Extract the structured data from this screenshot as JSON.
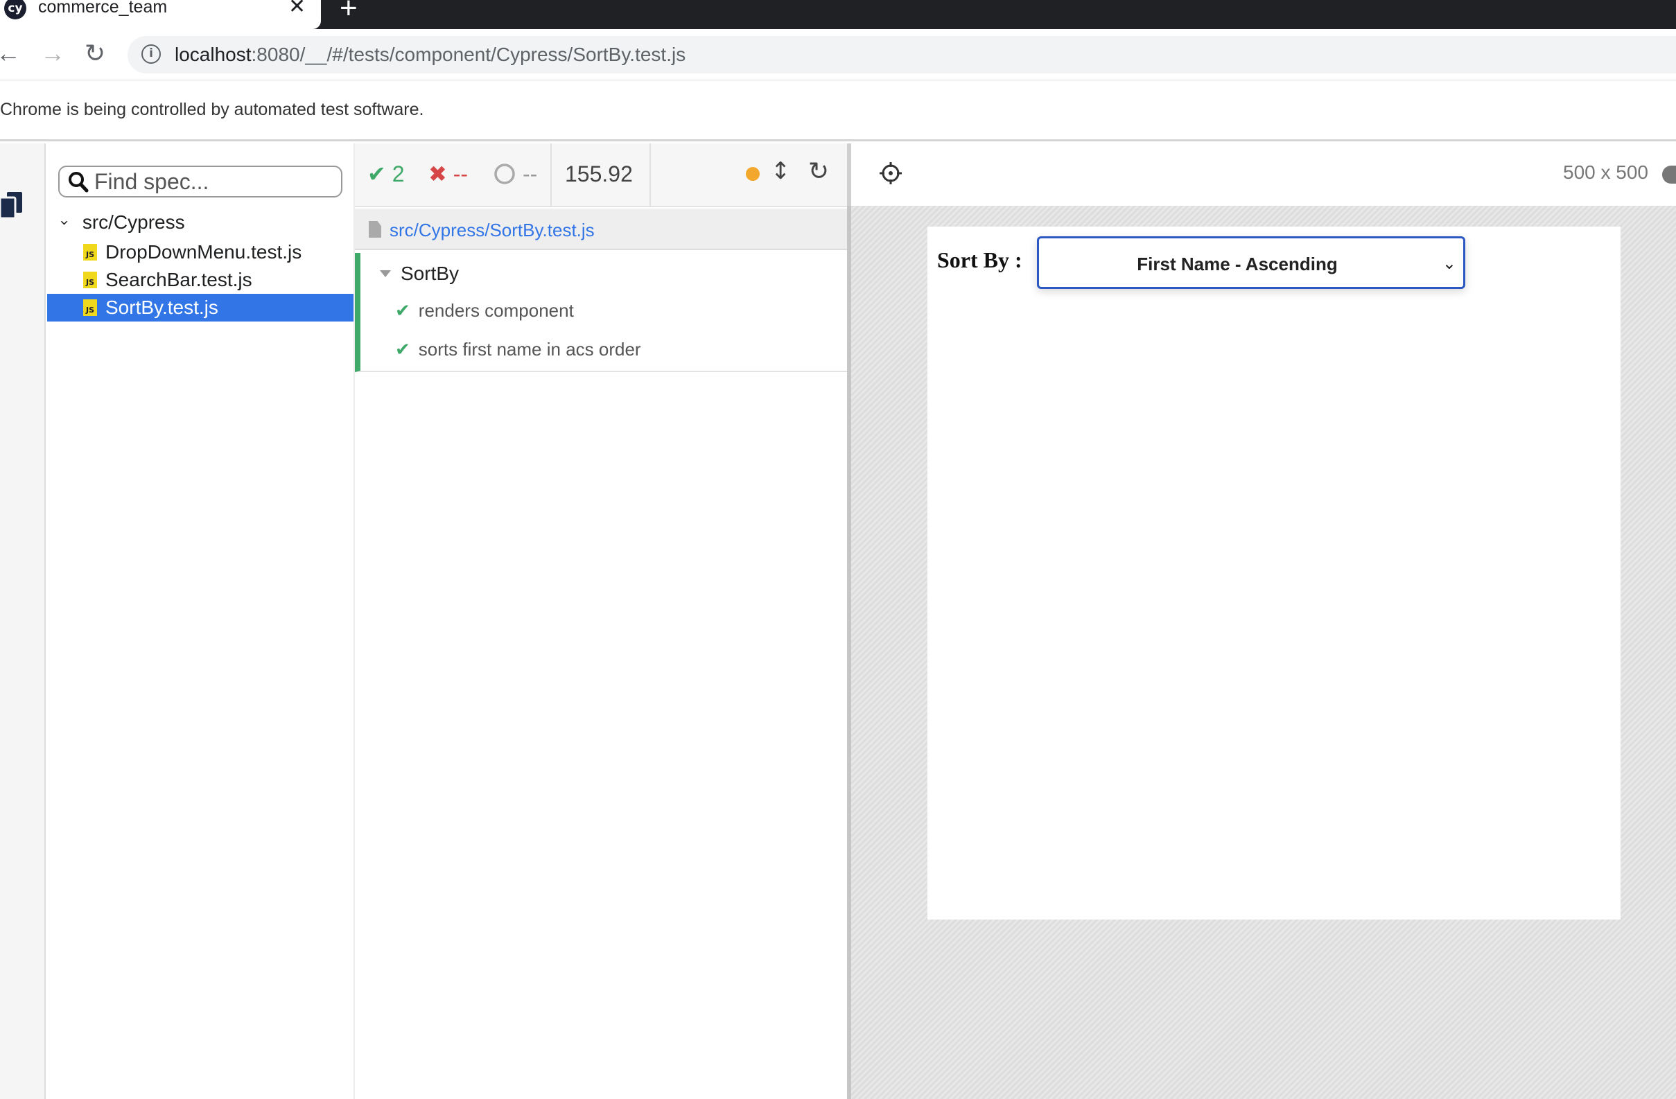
{
  "browser": {
    "tab_title": "commerce_team",
    "favicon_text": "cy",
    "close_glyph": "✕",
    "newtab_glyph": "+",
    "back_glyph": "←",
    "forward_glyph": "→",
    "reload_glyph": "↻",
    "info_glyph": "i",
    "url_host": "localhost",
    "url_rest": ":8080/__/#/tests/component/Cypress/SortBy.test.js",
    "infobar": "Chrome is being controlled by automated test software."
  },
  "specs": {
    "search_placeholder": "Find spec...",
    "folder": "src/Cypress",
    "files": [
      {
        "name": "DropDownMenu.test.js",
        "active": false
      },
      {
        "name": "SearchBar.test.js",
        "active": false
      },
      {
        "name": "SortBy.test.js",
        "active": true
      }
    ],
    "js_badge": "JS"
  },
  "reporter": {
    "passed": "2",
    "failed": "--",
    "pending": "--",
    "duration": "155.92",
    "pass_glyph": "✔",
    "fail_glyph": "✖",
    "runnable_path": "src/Cypress/SortBy.test.js",
    "suite": "SortBy",
    "tests": [
      "renders component",
      "sorts first name in acs order"
    ]
  },
  "aut": {
    "viewport": "500 x 500",
    "sort_label": "Sort By :",
    "select_value": "First Name - Ascending"
  },
  "colors": {
    "pass": "#3ea968",
    "fail": "#d64646",
    "active": "#3275e6",
    "running_dot": "#f4a72d"
  },
  "icons": [
    "search-icon",
    "document-icon",
    "selector-playground-icon",
    "reload-icon",
    "chevron-down-icon",
    "check-icon"
  ]
}
